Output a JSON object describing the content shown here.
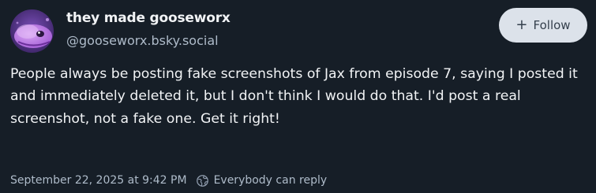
{
  "author": {
    "display_name": "they made gooseworx",
    "handle": "@gooseworx.bsky.social",
    "avatar_icon": "purple-creature-avatar"
  },
  "follow_button": {
    "icon": "plus-icon",
    "icon_glyph": "+",
    "label": "Follow"
  },
  "post": {
    "text": "People always be posting fake screenshots of Jax from episode 7, saying I posted it and immediately deleted it, but I don't think I would do that. I'd post a real screenshot, not a fake one. Get it right!"
  },
  "meta": {
    "timestamp": "September 22, 2025 at 9:42 PM",
    "reply_icon": "globe-icon",
    "reply_setting": "Everybody can reply"
  },
  "colors": {
    "background": "#161e27",
    "text": "#f1f3f5",
    "secondary_text": "#aebbc9",
    "follow_button_bg": "#dce2ea",
    "follow_button_text": "#35404d"
  }
}
